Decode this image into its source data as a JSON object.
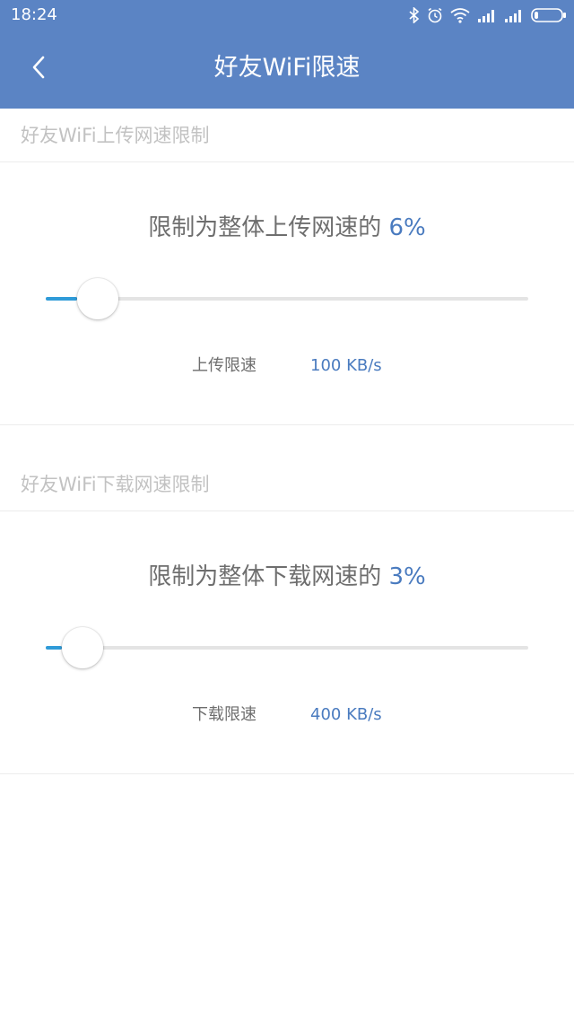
{
  "status_bar": {
    "time": "18:24",
    "icons": [
      "bluetooth-icon",
      "alarm-icon",
      "wifi-icon",
      "signal-icon",
      "signal-icon",
      "battery-icon"
    ]
  },
  "header": {
    "title": "好友WiFi限速",
    "back_icon": "chevron-left-icon"
  },
  "upload": {
    "section_label": "好友WiFi上传网速限制",
    "limit_prefix": "限制为整体上传网速的",
    "percent_text": "6%",
    "percent": 6,
    "speed_label": "上传限速",
    "speed_value": "100 KB/s"
  },
  "download": {
    "section_label": "好友WiFi下载网速限制",
    "limit_prefix": "限制为整体下载网速的",
    "percent_text": "3%",
    "percent": 3,
    "speed_label": "下载限速",
    "speed_value": "400 KB/s"
  },
  "colors": {
    "header_bg": "#5b84c4",
    "accent": "#4a7bbf",
    "slider_fill": "#2f9bd8",
    "track": "#e4e4e4"
  }
}
